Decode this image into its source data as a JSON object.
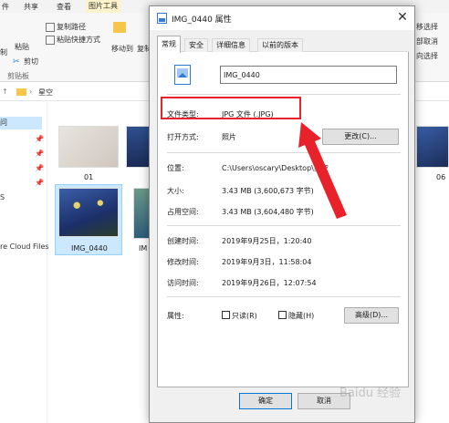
{
  "explorer": {
    "ribbon_tabs": [
      "件",
      "共享",
      "查看",
      "图片工具"
    ],
    "ribbon": {
      "copy_path": "复制路径",
      "paste_shortcut": "粘贴快捷方式",
      "cut": "剪切",
      "paste": "粘贴",
      "clipboard": "剪贴板",
      "copy_left": "制",
      "move_to": "移动到",
      "copy_to": "复制",
      "right_1": "移选择",
      "right_2": "部取消",
      "right_3": "向选择"
    },
    "address": {
      "path": "星空"
    },
    "nav": {
      "items": [
        "问",
        "S",
        "re Cloud Files"
      ]
    },
    "thumbnails": [
      {
        "label": "01"
      },
      {
        "label": "IMG_0440"
      },
      {
        "label": "IM"
      },
      {
        "label": "06"
      }
    ]
  },
  "dialog": {
    "title": "IMG_0440 属性",
    "close_glyph": "✕",
    "tabs": [
      "常规",
      "安全",
      "详细信息",
      "以前的版本"
    ],
    "file_name": "IMG_0440",
    "type_label": "文件类型:",
    "type_value": "JPG 文件 (.JPG)",
    "opens_label": "打开方式:",
    "opens_value": "照片",
    "change_button": "更改(C)...",
    "location_label": "位置:",
    "location_value": "C:\\Users\\oscary\\Desktop\\星空",
    "size_label": "大小:",
    "size_value": "3.43 MB (3,600,673 字节)",
    "disk_label": "占用空间:",
    "disk_value": "3.43 MB (3,604,480 字节)",
    "created_label": "创建时间:",
    "created_value": "2019年9月25日，1:20:40",
    "modified_label": "修改时间:",
    "modified_value": "2019年9月3日，11:58:04",
    "accessed_label": "访问时间:",
    "accessed_value": "2019年9月26日，12:07:54",
    "attr_label": "属性:",
    "readonly_label": "只读(R)",
    "hidden_label": "隐藏(H)",
    "advanced_button": "高级(D)...",
    "ok_button": "确定",
    "cancel_button": "取消"
  },
  "watermark": "Baidu 经验",
  "colors": {
    "highlight": "#e8222a",
    "selection": "#cce8ff",
    "accent": "#2e7bd6"
  }
}
